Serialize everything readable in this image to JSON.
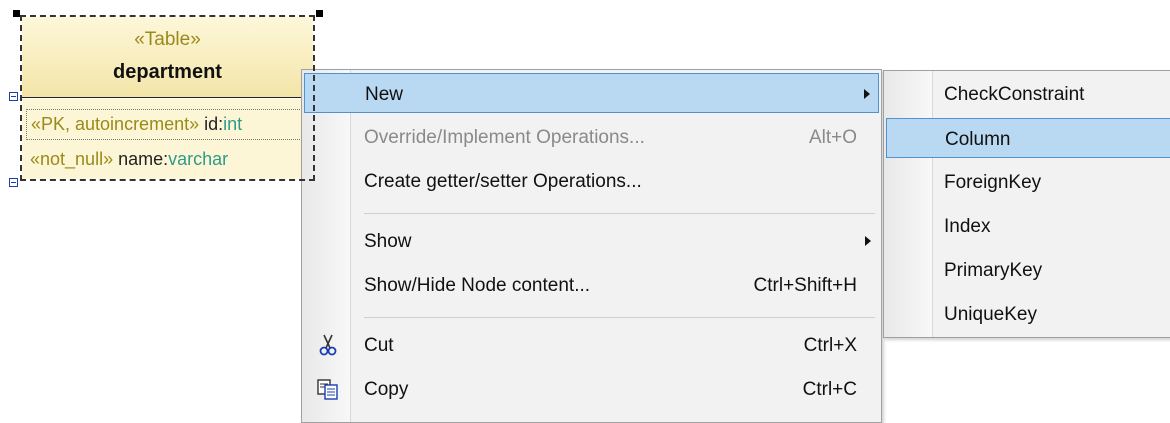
{
  "table_node": {
    "stereotype": "«Table»",
    "name": "department",
    "attributes": [
      {
        "stereotype": "«PK, autoincrement»",
        "name": "id",
        "sep": ":",
        "type": "int"
      },
      {
        "stereotype": "«not_null»",
        "name": "name",
        "sep": ":",
        "type": "varchar"
      }
    ]
  },
  "context_menu": {
    "items": [
      {
        "label": "New",
        "shortcut": "",
        "submenu": true,
        "highlighted": true
      },
      {
        "label": "Override/Implement Operations...",
        "shortcut": "Alt+O",
        "disabled": true
      },
      {
        "label": "Create getter/setter Operations...",
        "shortcut": ""
      },
      {
        "label": "Show",
        "shortcut": "",
        "submenu": true
      },
      {
        "label": "Show/Hide Node content...",
        "shortcut": "Ctrl+Shift+H"
      },
      {
        "label": "Cut",
        "shortcut": "Ctrl+X",
        "icon": "scissors-icon"
      },
      {
        "label": "Copy",
        "shortcut": "Ctrl+C",
        "icon": "copy-icon"
      }
    ]
  },
  "submenu_new": {
    "items": [
      "CheckConstraint",
      "Column",
      "ForeignKey",
      "Index",
      "PrimaryKey",
      "UniqueKey"
    ],
    "highlighted": "Column"
  },
  "colors": {
    "highlight": "#b9d8f2",
    "highlight_border": "#4f93d0",
    "stereotype": "#9a8a1a",
    "type": "#2f9a8a"
  }
}
